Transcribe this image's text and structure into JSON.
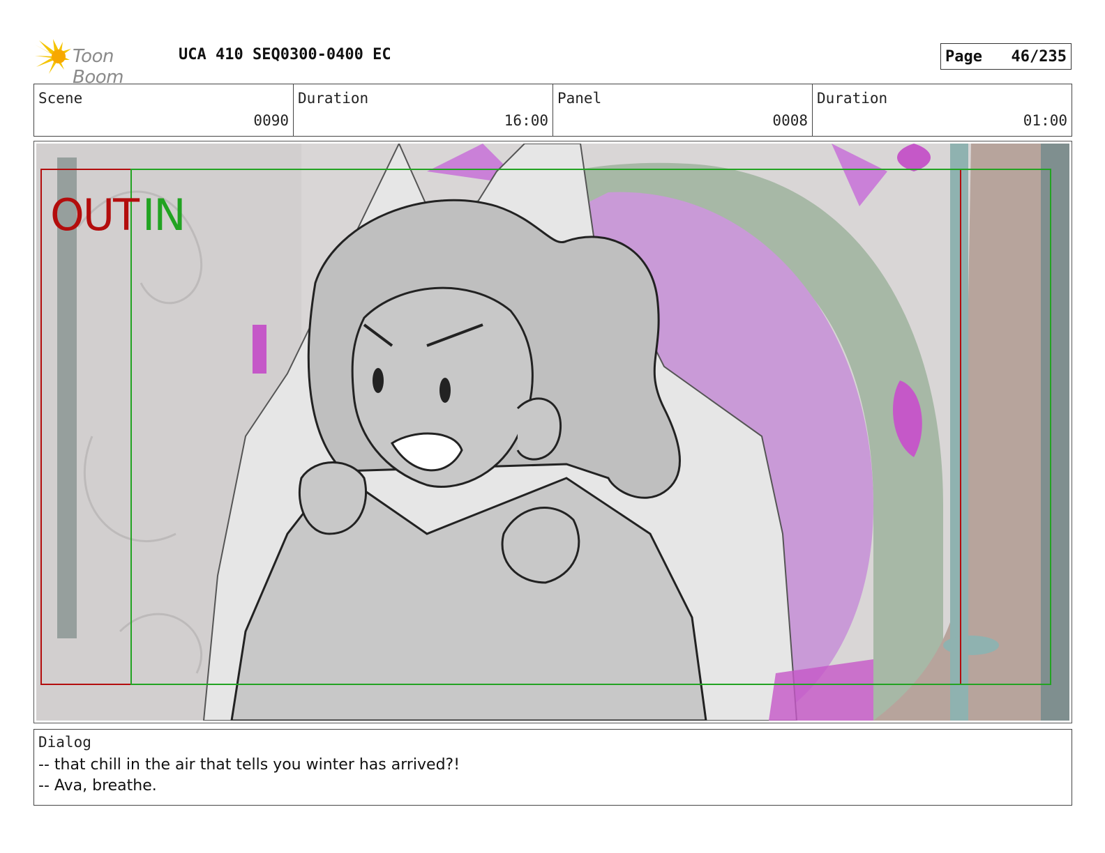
{
  "header": {
    "logo_text": "Toon Boom",
    "title": "UCA 410 SEQ0300-0400 EC",
    "page_label": "Page",
    "page_value": "46/235"
  },
  "info": {
    "scene_label": "Scene",
    "scene_value": "0090",
    "scene_duration_label": "Duration",
    "scene_duration_value": "16:00",
    "panel_label": "Panel",
    "panel_value": "0008",
    "panel_duration_label": "Duration",
    "panel_duration_value": "01:00"
  },
  "panel": {
    "out_label": "OUT",
    "in_label": "IN",
    "out_frame_color": "#b30d0d",
    "in_frame_color": "#22a322"
  },
  "dialog": {
    "label": "Dialog",
    "lines": [
      "-- that chill in the air that tells you winter has arrived?!",
      "-- Ava, breathe."
    ]
  }
}
